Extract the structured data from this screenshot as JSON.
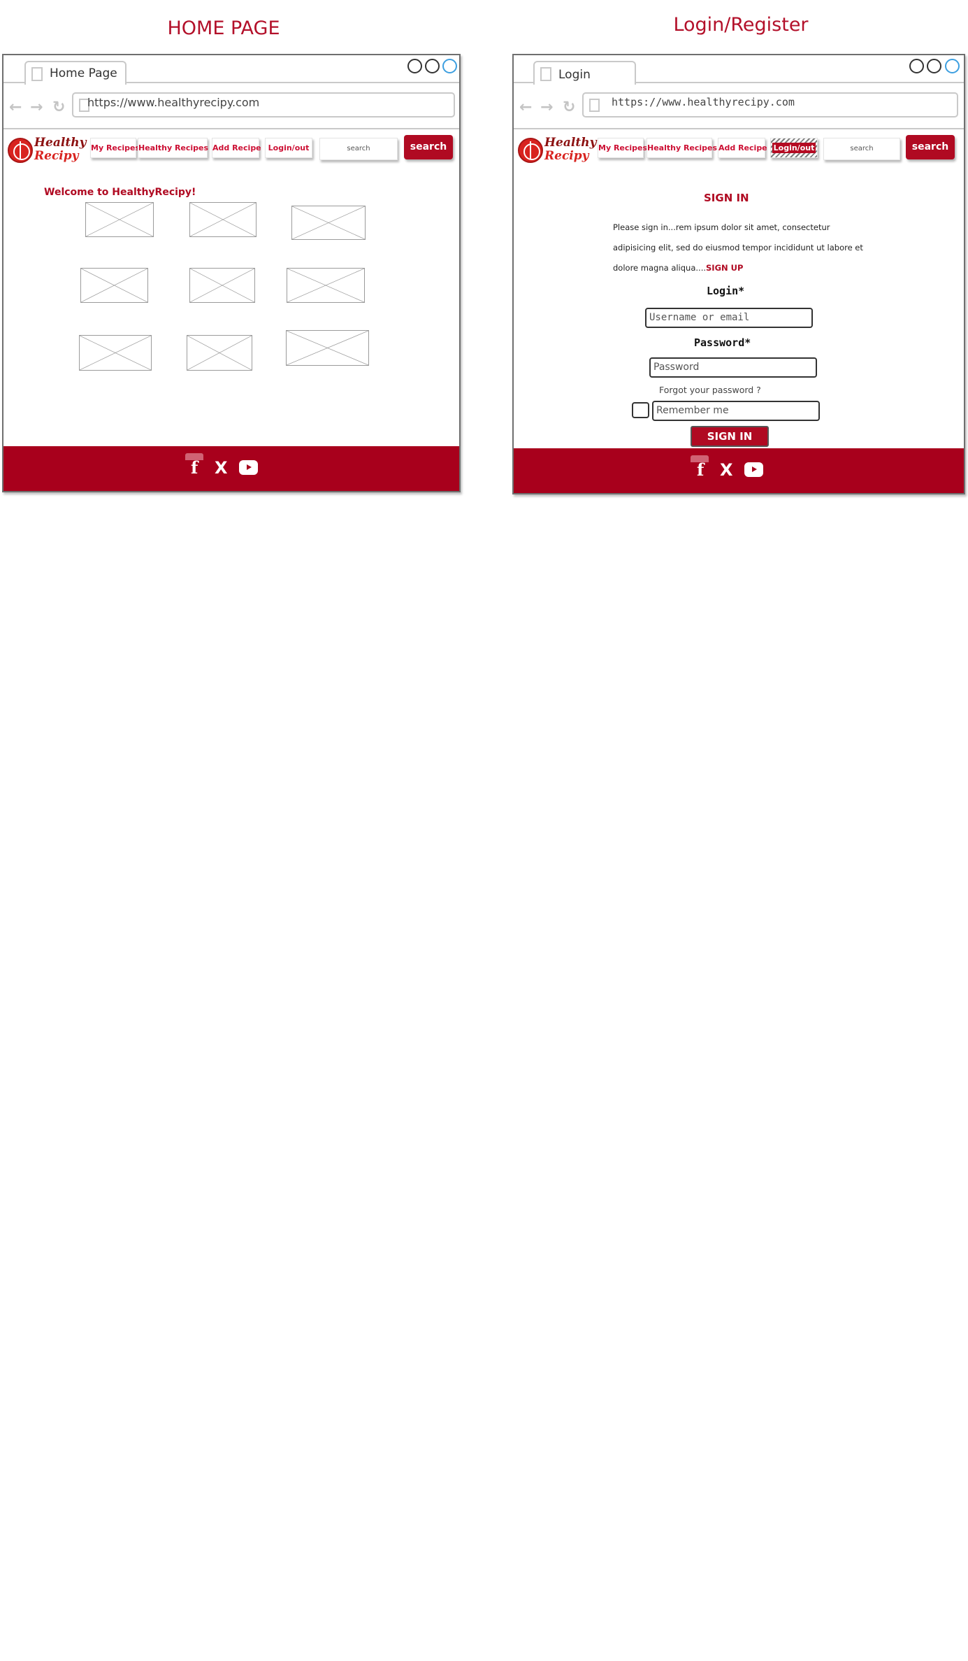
{
  "headings": {
    "home": "HOME PAGE",
    "login": "Login/Register"
  },
  "colors": {
    "brand": "#b00a22",
    "footer": "#a8001c",
    "link": "#cc1034"
  },
  "home": {
    "tab_label": "Home Page",
    "url": "https://www.healthyrecipy.com",
    "logo": {
      "line1": "Healthy",
      "line2": "Recipy"
    },
    "nav": {
      "my_recipes": "My Recipes",
      "healthy_recipes": "Healthy Recipes",
      "add_recipe": "Add Recipe",
      "login_out": "Login/out"
    },
    "search": {
      "placeholder": "search",
      "button": "search"
    },
    "welcome": "Welcome to HealthyRecipy!",
    "image_placeholders": 9,
    "footer": {
      "facebook": "f",
      "x": "X",
      "youtube": "youtube-icon"
    }
  },
  "login": {
    "tab_label": "Login",
    "url": "https://www.healthyrecipy.com",
    "logo": {
      "line1": "Healthy",
      "line2": "Recipy"
    },
    "nav": {
      "my_recipes": "My Recipes",
      "healthy_recipes": "Healthy Recipes",
      "add_recipe": "Add Recipe",
      "login_out": "Login/out"
    },
    "search": {
      "placeholder": "search",
      "button": "search"
    },
    "form": {
      "title": "SIGN IN",
      "intro_line1": "Please sign in...rem ipsum dolor sit amet, consectetur",
      "intro_line2": "adipisicing elit, sed do eiusmod tempor incididunt ut labore et",
      "intro_line3": "dolore magna aliqua....",
      "signup_link": "SIGN UP",
      "login_label": "Login*",
      "login_placeholder": "Username or email",
      "password_label": "Password*",
      "password_placeholder": "Password",
      "forgot": "Forgot your password ?",
      "remember": "Remember me",
      "submit": "SIGN IN"
    },
    "footer": {
      "facebook": "f",
      "x": "X",
      "youtube": "youtube-icon"
    }
  }
}
